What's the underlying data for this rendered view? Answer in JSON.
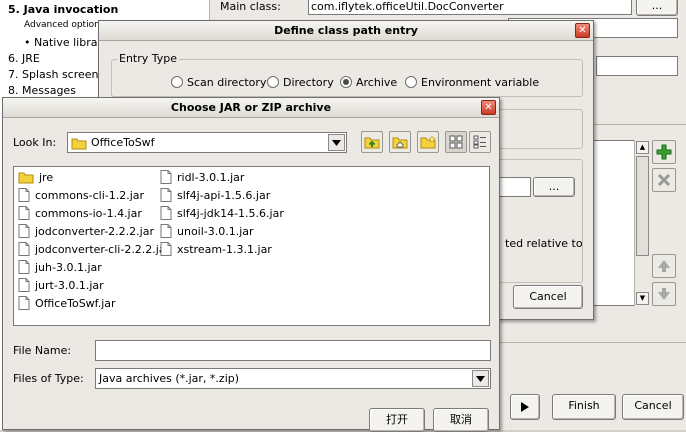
{
  "wizard": {
    "nav": {
      "items": [
        {
          "label": "5. Java invocation",
          "bold": true
        },
        {
          "label": "Advanced options",
          "small": true
        },
        {
          "label": "• Native librarie"
        },
        {
          "label": "6. JRE"
        },
        {
          "label": "7. Splash screen"
        },
        {
          "label": "8. Messages"
        }
      ]
    },
    "main_class_label": "Main class:",
    "main_class_value": "com.iflytek.officeUtil.DocConverter",
    "browse_label": "...",
    "bg_browse_label": "...",
    "relative_text": "ted relative to",
    "add_icon": "green-plus-icon",
    "remove_icon": "gray-x-icon",
    "finish_label": "Finish",
    "cancel_label": "Cancel"
  },
  "define_dialog": {
    "title": "Define class path entry",
    "entry_type_label": "Entry Type",
    "options": [
      "Scan directory",
      "Directory",
      "Archive",
      "Environment variable"
    ],
    "selected_index": 2,
    "cancel_label": "Cancel"
  },
  "chooser": {
    "title": "Choose JAR or ZIP archive",
    "look_in_label": "Look In:",
    "look_in_value": "OfficeToSwf",
    "toolbar_icons": [
      "up-folder-icon",
      "home-folder-icon",
      "new-folder-icon",
      "list-view-icon",
      "details-view-icon"
    ],
    "files_col1": [
      {
        "name": "jre",
        "type": "folder"
      },
      {
        "name": "commons-cli-1.2.jar",
        "type": "file"
      },
      {
        "name": "commons-io-1.4.jar",
        "type": "file"
      },
      {
        "name": "jodconverter-2.2.2.jar",
        "type": "file"
      },
      {
        "name": "jodconverter-cli-2.2.2.jar",
        "type": "file"
      },
      {
        "name": "juh-3.0.1.jar",
        "type": "file"
      },
      {
        "name": "jurt-3.0.1.jar",
        "type": "file"
      },
      {
        "name": "OfficeToSwf.jar",
        "type": "file"
      }
    ],
    "files_col2": [
      {
        "name": "ridl-3.0.1.jar",
        "type": "file"
      },
      {
        "name": "slf4j-api-1.5.6.jar",
        "type": "file"
      },
      {
        "name": "slf4j-jdk14-1.5.6.jar",
        "type": "file"
      },
      {
        "name": "unoil-3.0.1.jar",
        "type": "file"
      },
      {
        "name": "xstream-1.3.1.jar",
        "type": "file"
      }
    ],
    "file_name_label": "File Name:",
    "file_name_value": "",
    "file_type_label": "Files of Type:",
    "file_type_value": "Java archives (*.jar, *.zip)",
    "open_label": "打开",
    "cancel_label": "取消"
  }
}
